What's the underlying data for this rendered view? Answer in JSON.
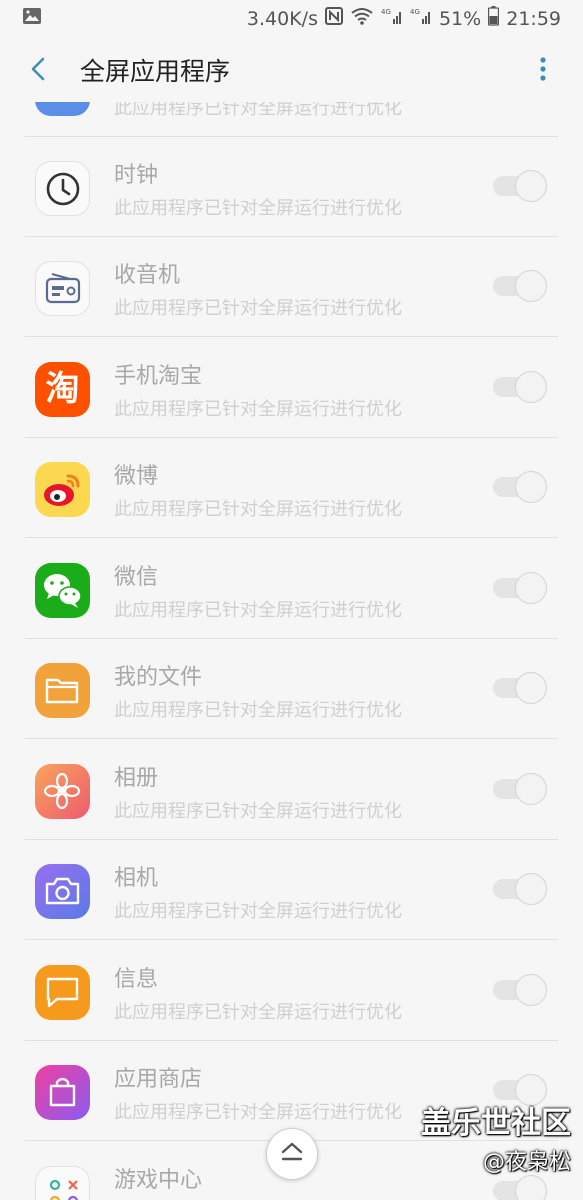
{
  "status_bar": {
    "net_speed": "3.40K/s",
    "battery": "51%",
    "time": "21:59",
    "icons": [
      "image-icon",
      "nfc-icon",
      "wifi-icon",
      "signal-4g-icon",
      "signal-4g-icon",
      "battery-icon"
    ]
  },
  "app_bar": {
    "title": "全屏应用程序",
    "back_icon": "chevron-left-icon",
    "more_icon": "more-vertical-icon"
  },
  "list": {
    "partial_top_desc": "此应用程序已针对全屏运行进行优化",
    "items": [
      {
        "name": "时钟",
        "desc": "此应用程序已针对全屏运行进行优化",
        "icon": "clock-icon",
        "enabled": false
      },
      {
        "name": "收音机",
        "desc": "此应用程序已针对全屏运行进行优化",
        "icon": "radio-icon",
        "enabled": false
      },
      {
        "name": "手机淘宝",
        "desc": "此应用程序已针对全屏运行进行优化",
        "icon": "taobao-icon",
        "icon_text": "淘",
        "enabled": false
      },
      {
        "name": "微博",
        "desc": "此应用程序已针对全屏运行进行优化",
        "icon": "weibo-icon",
        "enabled": false
      },
      {
        "name": "微信",
        "desc": "此应用程序已针对全屏运行进行优化",
        "icon": "wechat-icon",
        "enabled": false
      },
      {
        "name": "我的文件",
        "desc": "此应用程序已针对全屏运行进行优化",
        "icon": "folder-icon",
        "enabled": false
      },
      {
        "name": "相册",
        "desc": "此应用程序已针对全屏运行进行优化",
        "icon": "gallery-icon",
        "enabled": false
      },
      {
        "name": "相机",
        "desc": "此应用程序已针对全屏运行进行优化",
        "icon": "camera-icon",
        "enabled": false
      },
      {
        "name": "信息",
        "desc": "此应用程序已针对全屏运行进行优化",
        "icon": "message-icon",
        "enabled": false
      },
      {
        "name": "应用商店",
        "desc": "此应用程序已针对全屏运行进行优化",
        "icon": "app-store-icon",
        "enabled": false
      },
      {
        "name": "游戏中心",
        "desc": "",
        "icon": "game-center-icon",
        "enabled": false
      }
    ]
  },
  "scroll_top_icon": "chevron-up-icon",
  "watermark": {
    "line1": "盖乐世社区",
    "line2": "@夜枭松"
  },
  "colors": {
    "accent": "#3a8fb7",
    "background": "#f6f6f6",
    "disabled_text": "#a8a8a8"
  }
}
